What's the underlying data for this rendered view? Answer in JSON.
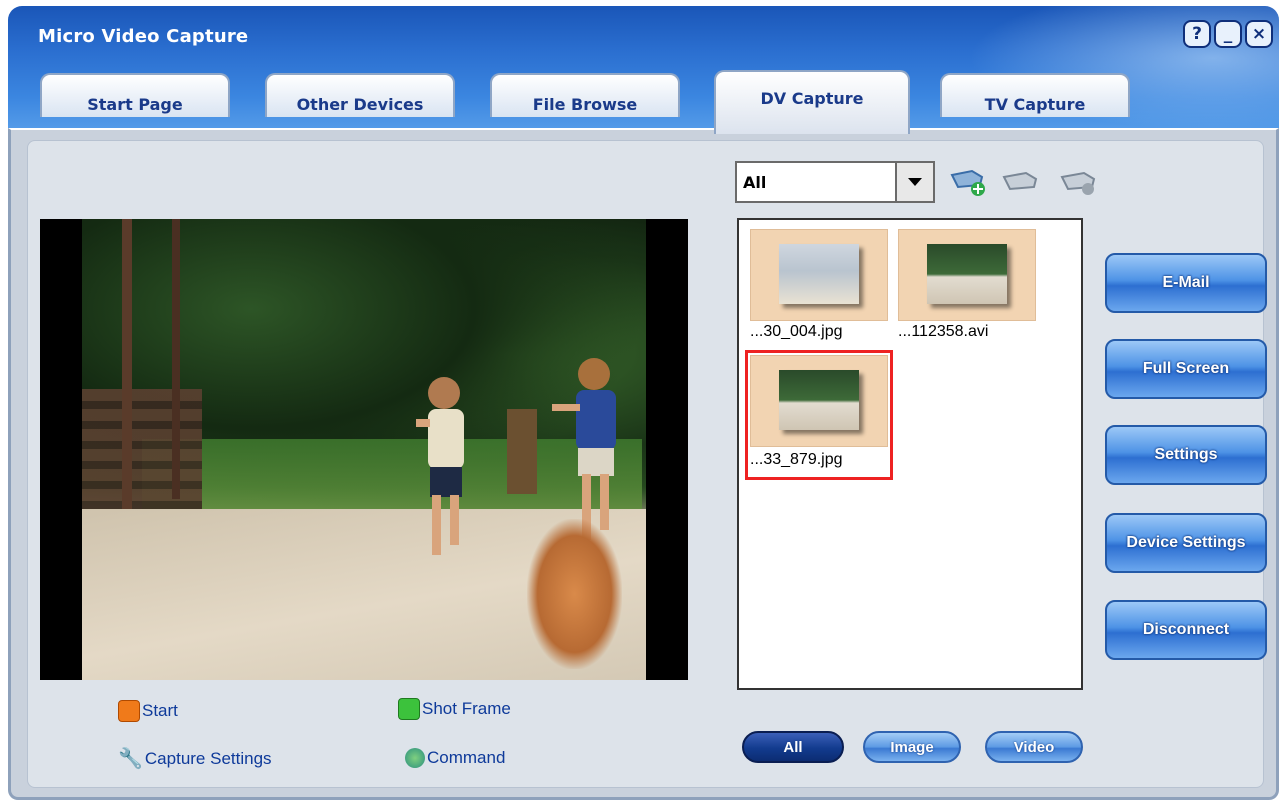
{
  "window": {
    "title": "Micro Video Capture",
    "controls": {
      "help": "?",
      "minimize": "_",
      "close": "×"
    }
  },
  "tabs": [
    {
      "label": "Start Page",
      "active": false
    },
    {
      "label": "Other Devices",
      "active": false
    },
    {
      "label": "File Browse",
      "active": false
    },
    {
      "label": "DV Capture",
      "active": true
    },
    {
      "label": "TV Capture",
      "active": false
    }
  ],
  "filter_dropdown": {
    "value": "All"
  },
  "gallery": {
    "items": [
      {
        "name": "...30_004.jpg",
        "type": "image",
        "selected": false
      },
      {
        "name": "...112358.avi",
        "type": "video",
        "selected": false
      },
      {
        "name": "...33_879.jpg",
        "type": "image",
        "selected": true
      }
    ]
  },
  "right_buttons": {
    "email": "E-Mail",
    "full_screen": "Full Screen",
    "settings": "Settings",
    "device_settings": "Device Settings",
    "disconnect": "Disconnect"
  },
  "filter_buttons": {
    "all": "All",
    "image": "Image",
    "video": "Video"
  },
  "capture_controls": {
    "start": "Start",
    "shot_frame": "Shot Frame",
    "capture_settings": "Capture Settings",
    "command": "Command"
  },
  "colors": {
    "accent": "#2d6fd1",
    "selection": "#e22222",
    "thumb_bg": "#f2d4b2"
  }
}
